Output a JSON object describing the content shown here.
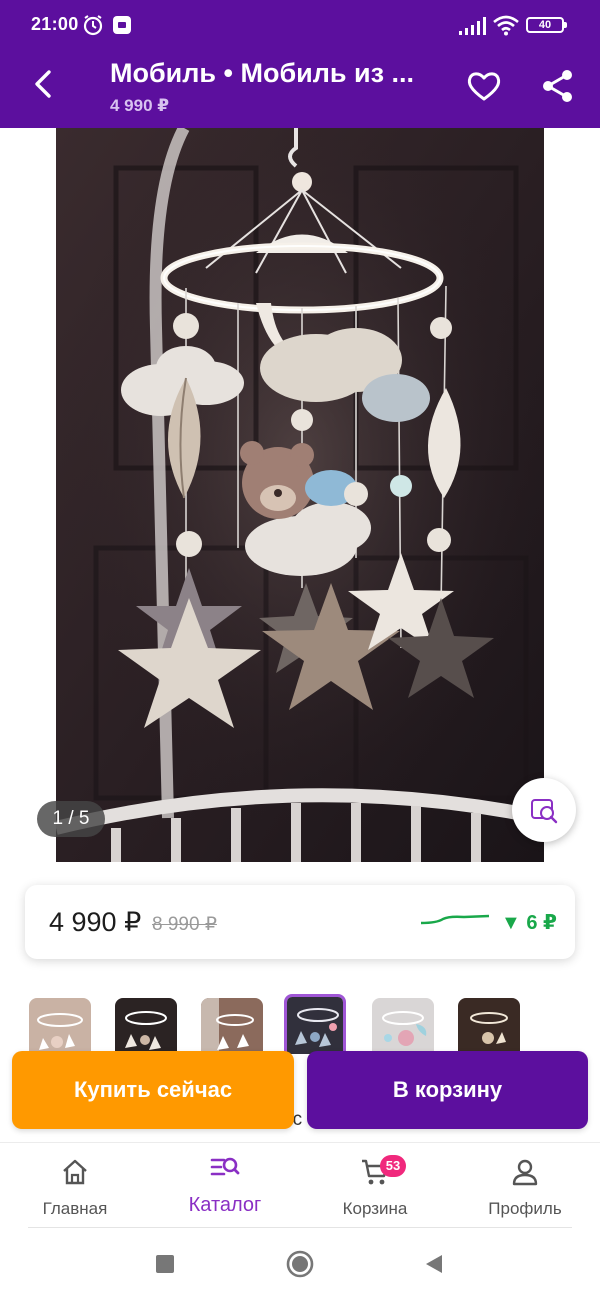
{
  "status_bar": {
    "time": "21:00",
    "battery": "40"
  },
  "header": {
    "title": "Мобиль • Мобиль из ...",
    "price": "4 990 ₽",
    "icons": [
      "back-arrow-icon",
      "heart-icon",
      "share-icon"
    ]
  },
  "gallery": {
    "counter": "1 / 5",
    "visual_search_icon": "image-search-icon"
  },
  "price_card": {
    "current_price": "4 990 ₽",
    "old_price": "8 990 ₽",
    "price_change": "▼ 6 ₽",
    "trend_color": "#19a84a"
  },
  "behind_text": "ис",
  "actions": {
    "buy_now": "Купить сейчас",
    "add_to_cart": "В корзину",
    "buy_color": "#ff9900",
    "cart_color": "#5c0f9e"
  },
  "bottom_nav": {
    "items": [
      {
        "label": "Главная",
        "icon": "home-icon"
      },
      {
        "label": "Каталог",
        "icon": "catalog-search-icon"
      },
      {
        "label": "Корзина",
        "icon": "cart-icon"
      },
      {
        "label": "Профиль",
        "icon": "profile-icon"
      }
    ],
    "cart_badge": "53",
    "accent": "#8a2fc4"
  }
}
